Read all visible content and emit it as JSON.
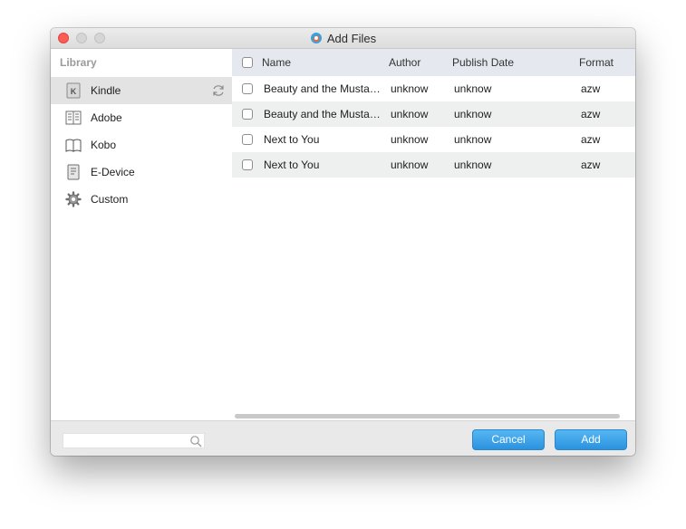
{
  "window": {
    "title": "Add Files"
  },
  "sidebar": {
    "heading": "Library",
    "items": [
      {
        "label": "Kindle",
        "icon": "kindle-icon",
        "selected": true
      },
      {
        "label": "Adobe",
        "icon": "adobe-book-icon"
      },
      {
        "label": "Kobo",
        "icon": "kobo-book-icon"
      },
      {
        "label": "E-Device",
        "icon": "e-device-icon"
      },
      {
        "label": "Custom",
        "icon": "gear-icon"
      }
    ]
  },
  "table": {
    "columns": [
      "Name",
      "Author",
      "Publish Date",
      "Format"
    ],
    "rows": [
      {
        "name": "Beauty and the Mustache",
        "author": "unknow",
        "date": "unknow",
        "format": "azw"
      },
      {
        "name": "Beauty and the Mustache",
        "author": "unknow",
        "date": "unknow",
        "format": "azw"
      },
      {
        "name": "Next to You",
        "author": "unknow",
        "date": "unknow",
        "format": "azw"
      },
      {
        "name": "Next to You",
        "author": "unknow",
        "date": "unknow",
        "format": "azw"
      }
    ]
  },
  "search": {
    "value": "",
    "placeholder": ""
  },
  "buttons": {
    "cancel": "Cancel",
    "add": "Add"
  },
  "colors": {
    "accent": "#2b92df",
    "selected_row": "#e3e3e3",
    "header_bg": "#e5e9ef"
  }
}
